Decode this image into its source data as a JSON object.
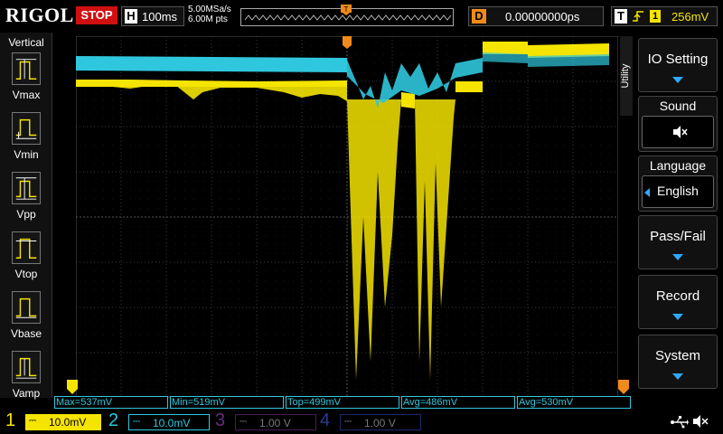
{
  "header": {
    "brand": "RIGOL",
    "run_state": "STOP",
    "horizontal": {
      "letter": "H",
      "timebase": "100ms"
    },
    "sample_rate": "5.00MSa/s",
    "memory_depth": "6.00M pts",
    "delay": {
      "letter": "D",
      "value": "0.00000000ps"
    },
    "trigger": {
      "letter": "T",
      "channel": "1",
      "level": "256mV"
    }
  },
  "left_panel": {
    "title": "Vertical",
    "items": [
      {
        "label": "Vmax"
      },
      {
        "label": "Vmin"
      },
      {
        "label": "Vpp"
      },
      {
        "label": "Vtop"
      },
      {
        "label": "Vbase"
      },
      {
        "label": "Vamp"
      }
    ]
  },
  "right_menu": {
    "utility_tab": "Utility",
    "io_setting": "IO Setting",
    "sound_title": "Sound",
    "language_title": "Language",
    "language_value": "English",
    "pass_fail": "Pass/Fail",
    "record": "Record",
    "system": "System"
  },
  "results": [
    "Max=537mV",
    "Min=519mV",
    "Top=499mV",
    "Avg=486mV",
    "Avg=530mV"
  ],
  "channels": [
    {
      "num": "1",
      "coupling": "⎓",
      "scale": "10.0mV",
      "color": "#f5e400"
    },
    {
      "num": "2",
      "coupling": "⎓",
      "scale": "10.0mV",
      "color": "#2fc7dd"
    },
    {
      "num": "3",
      "coupling": "⎓",
      "scale": "1.00 V",
      "color": "#8a3aa0"
    },
    {
      "num": "4",
      "coupling": "⎓",
      "scale": "1.00 V",
      "color": "#3050c0"
    }
  ],
  "colors": {
    "ch1": "#f5e400",
    "ch2": "#2fc7dd",
    "trigger_marker": "#f08a1a",
    "stop": "#d01010"
  },
  "icons": {
    "sound": "speaker-muted-icon",
    "usb": "usb-icon",
    "mute": "speaker-muted-icon",
    "trigger_edge": "rising-edge-icon"
  }
}
